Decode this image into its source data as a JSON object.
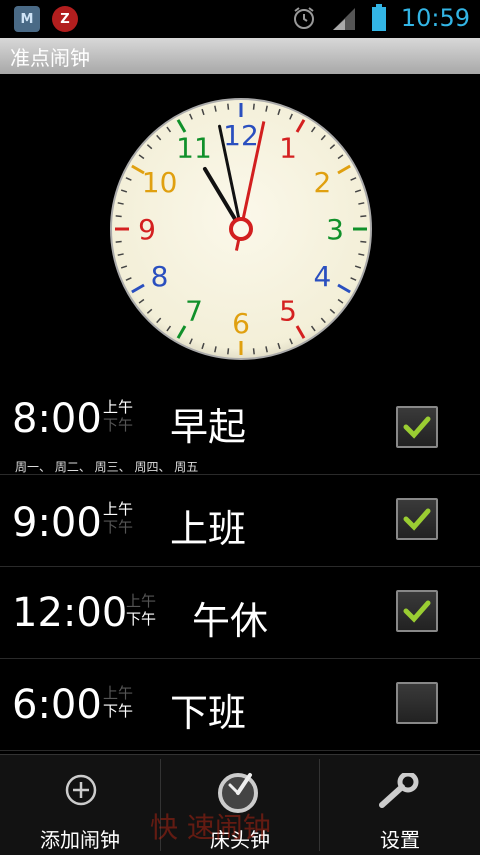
{
  "status_bar": {
    "time": "10:59",
    "app_icon_1": "M",
    "app_icon_2": "Z"
  },
  "title": "准点闹钟",
  "clock": {
    "hour": 10,
    "minute": 58,
    "second": 2,
    "numerals": [
      "12",
      "1",
      "2",
      "3",
      "4",
      "5",
      "6",
      "7",
      "8",
      "9",
      "10",
      "11"
    ],
    "numeral_colors": [
      "#2a4fbf",
      "#d42020",
      "#e0a010",
      "#10902a",
      "#2a4fbf",
      "#d42020",
      "#e0a010",
      "#10902a",
      "#2a4fbf",
      "#d42020",
      "#e0a010",
      "#10902a"
    ]
  },
  "alarms": [
    {
      "time": "8:00",
      "am": "上午",
      "pm": "下午",
      "selected": "am",
      "label": "早起",
      "days": "周一、 周二、 周三、 周四、 周五",
      "enabled": true
    },
    {
      "time": "9:00",
      "am": "上午",
      "pm": "下午",
      "selected": "am",
      "label": "上班",
      "days": "",
      "enabled": true
    },
    {
      "time": "12:00",
      "am": "上午",
      "pm": "下午",
      "selected": "pm",
      "label": "午休",
      "days": "",
      "enabled": true
    },
    {
      "time": "6:00",
      "am": "上午",
      "pm": "下午",
      "selected": "pm",
      "label": "下班",
      "days": "",
      "enabled": false
    }
  ],
  "bottom_bar": {
    "add_alarm": "添加闹钟",
    "bedside_clock": "床头钟",
    "settings": "设置"
  },
  "watermark": "快 速闹钟",
  "colors": {
    "accent_blue": "#33b5e5",
    "check_green": "#9acd32"
  }
}
